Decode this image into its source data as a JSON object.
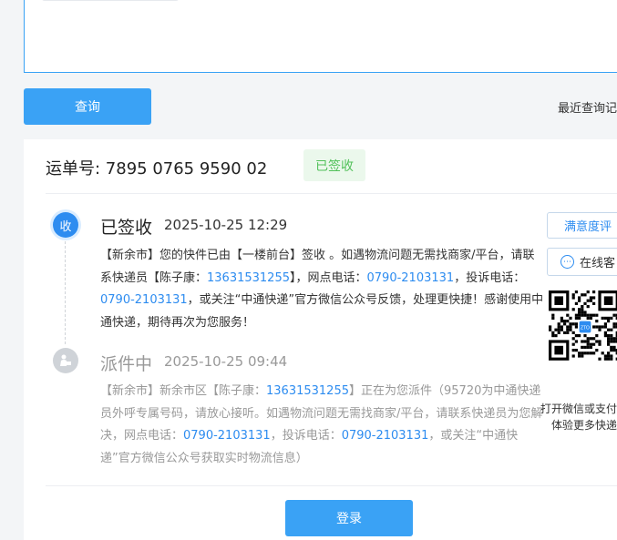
{
  "query_button": "查询",
  "recent_queries": "最近查询记",
  "waybill": "运单号: 7895 0765 9590 02",
  "badge": "已签收",
  "events": [
    {
      "icon_char": "收",
      "status": "已签收",
      "time": "2025-10-25 12:29",
      "parts": [
        {
          "t": "【新余市】您的快件已由【一楼前台】签收 。如遇物流问题无需找商家/平台，请联系快递员【陈子康："
        },
        {
          "t": "13631531255",
          "hl": true
        },
        {
          "t": "】，网点电话："
        },
        {
          "t": "0790-2103131",
          "hl": true
        },
        {
          "t": "，投诉电话："
        },
        {
          "t": "0790-2103131",
          "hl": true
        },
        {
          "t": "，或关注“中通快递”官方微信公众号反馈，处理更快捷！感谢使用中通快递，期待再次为您服务！"
        }
      ]
    },
    {
      "icon_char": "",
      "status": "派件中",
      "time": "2025-10-25 09:44",
      "parts": [
        {
          "t": "【新余市】新余市区【陈子康："
        },
        {
          "t": "13631531255",
          "hl": true
        },
        {
          "t": "】正在为您派件（95720为中通快递员外呼专属号码，请放心接听。如遇物流问题无需找商家/平台，请联系快递员为您解决，网点电话："
        },
        {
          "t": "0790-2103131",
          "hl": true
        },
        {
          "t": "，投诉电话："
        },
        {
          "t": "0790-2103131",
          "hl": true
        },
        {
          "t": "，或关注“中通快递”官方微信公众号获取实时物流信息）"
        }
      ]
    }
  ],
  "satisfaction_button": "满意度评",
  "online_button": "在线客",
  "qr_logo_text": "ZTO",
  "qr_caption_line1": "打开微信或支付",
  "qr_caption_line2": "体验更多快递",
  "login_button": "登录",
  "colors": {
    "accent": "#3aa2f5",
    "link": "#2d8cf0",
    "success": "#52c15a"
  }
}
